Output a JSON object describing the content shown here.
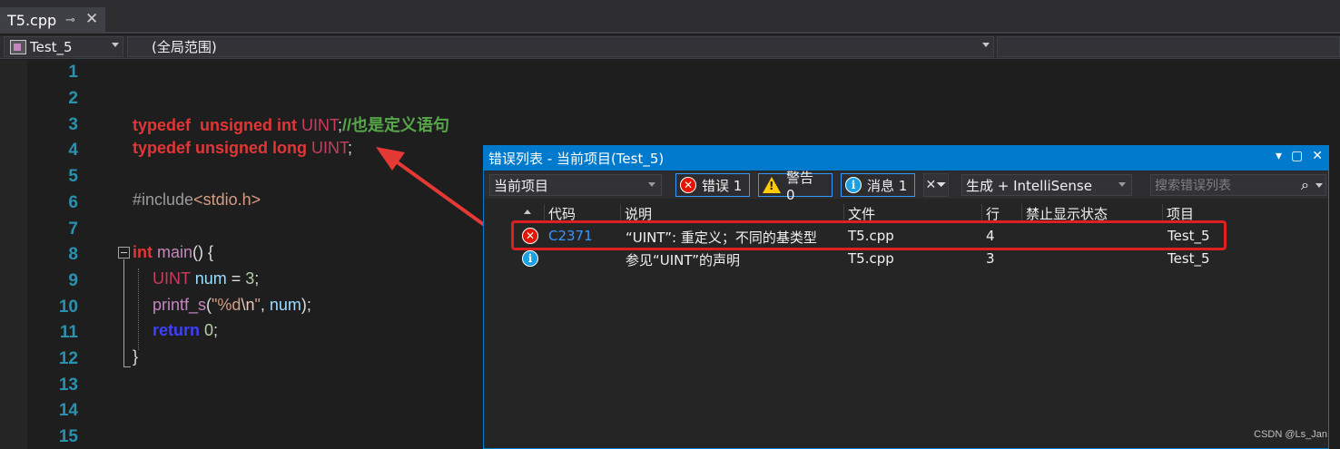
{
  "tab": {
    "title": "T5.cpp",
    "pin_icon": "pin-icon",
    "close_icon": "close-icon"
  },
  "navbar": {
    "project": "Test_5",
    "scope": "(全局范围)"
  },
  "editor": {
    "line_numbers": [
      "1",
      "2",
      "3",
      "4",
      "5",
      "6",
      "7",
      "8",
      "9",
      "10",
      "11",
      "12",
      "13",
      "14",
      "15"
    ],
    "line3": {
      "kw": "typedef  unsigned int",
      "type": "UINT",
      "semi": ";",
      "comment": "//也是定义语句"
    },
    "line4": {
      "kw": "typedef unsigned long",
      "type": "UINT",
      "semi": ";"
    },
    "line6": {
      "directive": "#include",
      "header": "<stdio.h>"
    },
    "line8": {
      "kw": "int",
      "fn": "main",
      "rest": "() {"
    },
    "line9": {
      "type": "UINT",
      "var": "num",
      "op": " = ",
      "num": "3",
      "semi": ";"
    },
    "line10": {
      "fn": "printf_s",
      "open": "(",
      "str1": "\"%d",
      "esc": "\\n",
      "str2": "\"",
      "comma": ", ",
      "var": "num",
      "close": ");"
    },
    "line11": {
      "kw": "return",
      "num": "0",
      "semi": ";"
    },
    "line12": {
      "brace": "}"
    }
  },
  "error_list": {
    "title": "错误列表 - 当前项目(Test_5)",
    "scope_dropdown": "当前项目",
    "errors_btn": "错误 1",
    "warnings_btn": "警告 0",
    "messages_btn": "消息 1",
    "build_dropdown": "生成 + IntelliSense",
    "search_placeholder": "搜索错误列表",
    "columns": [
      "代码",
      "说明",
      "文件",
      "行",
      "禁止显示状态",
      "项目"
    ],
    "rows": [
      {
        "icon": "error-icon",
        "code": "C2371",
        "desc": "“UINT”: 重定义；不同的基类型",
        "file": "T5.cpp",
        "line": "4",
        "suppress": "",
        "project": "Test_5"
      },
      {
        "icon": "info-icon",
        "code": "",
        "desc": "参见“UINT”的声明",
        "file": "T5.cpp",
        "line": "3",
        "suppress": "",
        "project": "Test_5"
      }
    ]
  },
  "watermark": "CSDN @Ls_Jan",
  "colors": {
    "accent": "#007acc",
    "highlight": "#e02020",
    "error": "#e51400",
    "info": "#1ba1e2",
    "warning": "#ffcc00"
  }
}
